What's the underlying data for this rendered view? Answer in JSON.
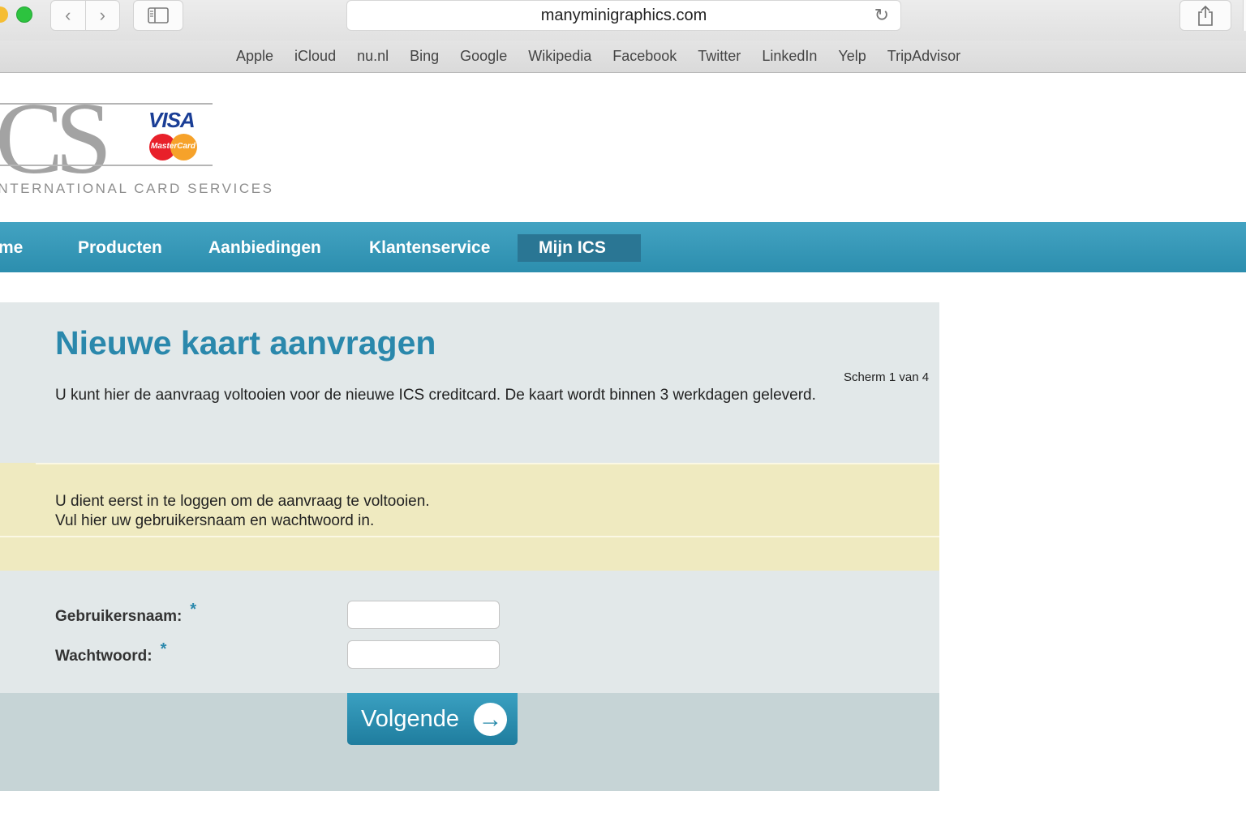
{
  "browser": {
    "url": "manyminigraphics.com",
    "icons": {
      "back": "chevron-left-icon",
      "forward": "chevron-right-icon",
      "sidebar": "sidebar-icon",
      "reload": "reload-icon",
      "share": "share-icon"
    },
    "favorites": [
      "Apple",
      "iCloud",
      "nu.nl",
      "Bing",
      "Google",
      "Wikipedia",
      "Facebook",
      "Twitter",
      "LinkedIn",
      "Yelp",
      "TripAdvisor"
    ]
  },
  "logo": {
    "ics": "ICS",
    "visa": "VISA",
    "mastercard": "MasterCard",
    "subtitle": "INTERNATIONAL CARD SERVICES"
  },
  "nav": {
    "items": [
      "Home",
      "Producten",
      "Aanbiedingen",
      "Klantenservice",
      "Mijn ICS"
    ],
    "active": "Mijn ICS",
    "color": "#349ab9"
  },
  "content": {
    "title": "Nieuwe kaart aanvragen",
    "step": "Scherm 1 van 4",
    "intro": "U kunt hier de aanvraag voltooien voor de nieuwe ICS creditcard. De kaart wordt binnen 3 werkdagen geleverd."
  },
  "notice": {
    "line1": "U dient eerst in te loggen om de aanvraag te voltooien.",
    "line2": "Vul hier uw gebruikersnaam en wachtwoord in."
  },
  "form": {
    "username_label": "Gebruikersnaam:",
    "password_label": "Wachtwoord:",
    "required_mark": "*",
    "username_value": "",
    "password_value": "",
    "submit_label": "Volgende",
    "submit_icon": "arrow-right-circle-icon"
  }
}
